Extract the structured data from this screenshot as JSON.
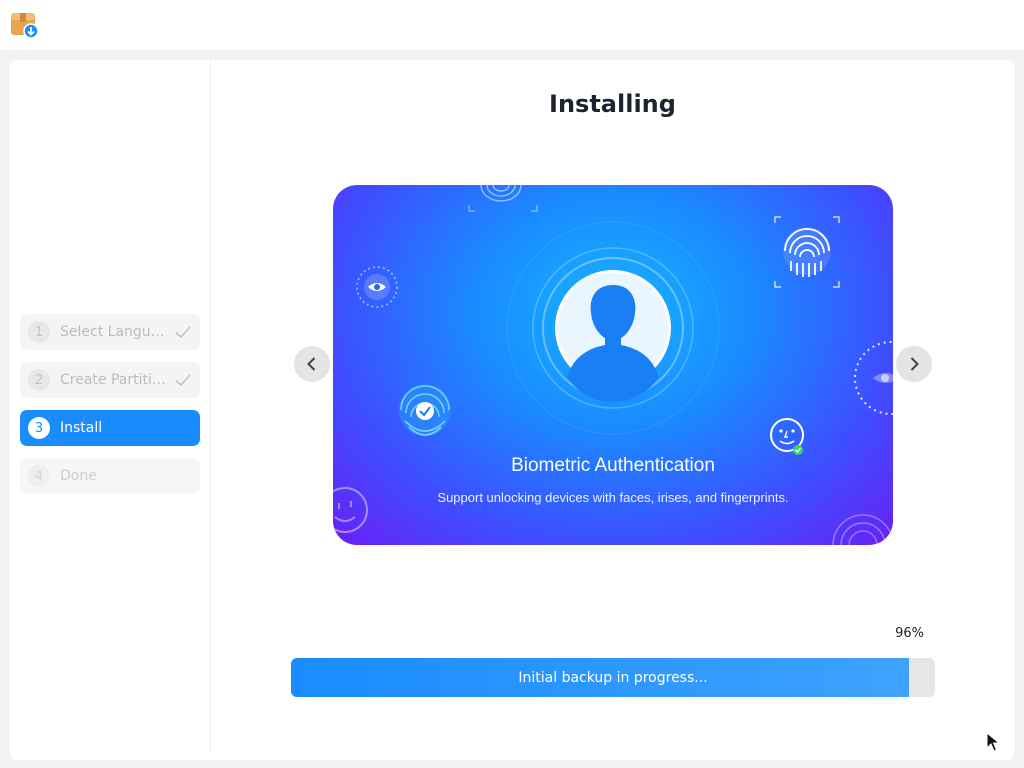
{
  "app": {
    "icon": "installer-package-icon"
  },
  "sidebar": {
    "steps": [
      {
        "number": "1",
        "label": "Select Language",
        "status": "completed"
      },
      {
        "number": "2",
        "label": "Create Partitions",
        "status": "completed"
      },
      {
        "number": "3",
        "label": "Install",
        "status": "active"
      },
      {
        "number": "4",
        "label": "Done",
        "status": "pending"
      }
    ]
  },
  "main": {
    "title": "Installing",
    "slide": {
      "heading": "Biometric Authentication",
      "subtitle": "Support unlocking devices with faces, irises, and fingerprints."
    },
    "progress": {
      "percent_label": "96%",
      "value": 0.96,
      "status": "Initial backup in progress..."
    }
  },
  "colors": {
    "accent": "#1a8cff",
    "progress_track": "#e6e6e6"
  }
}
